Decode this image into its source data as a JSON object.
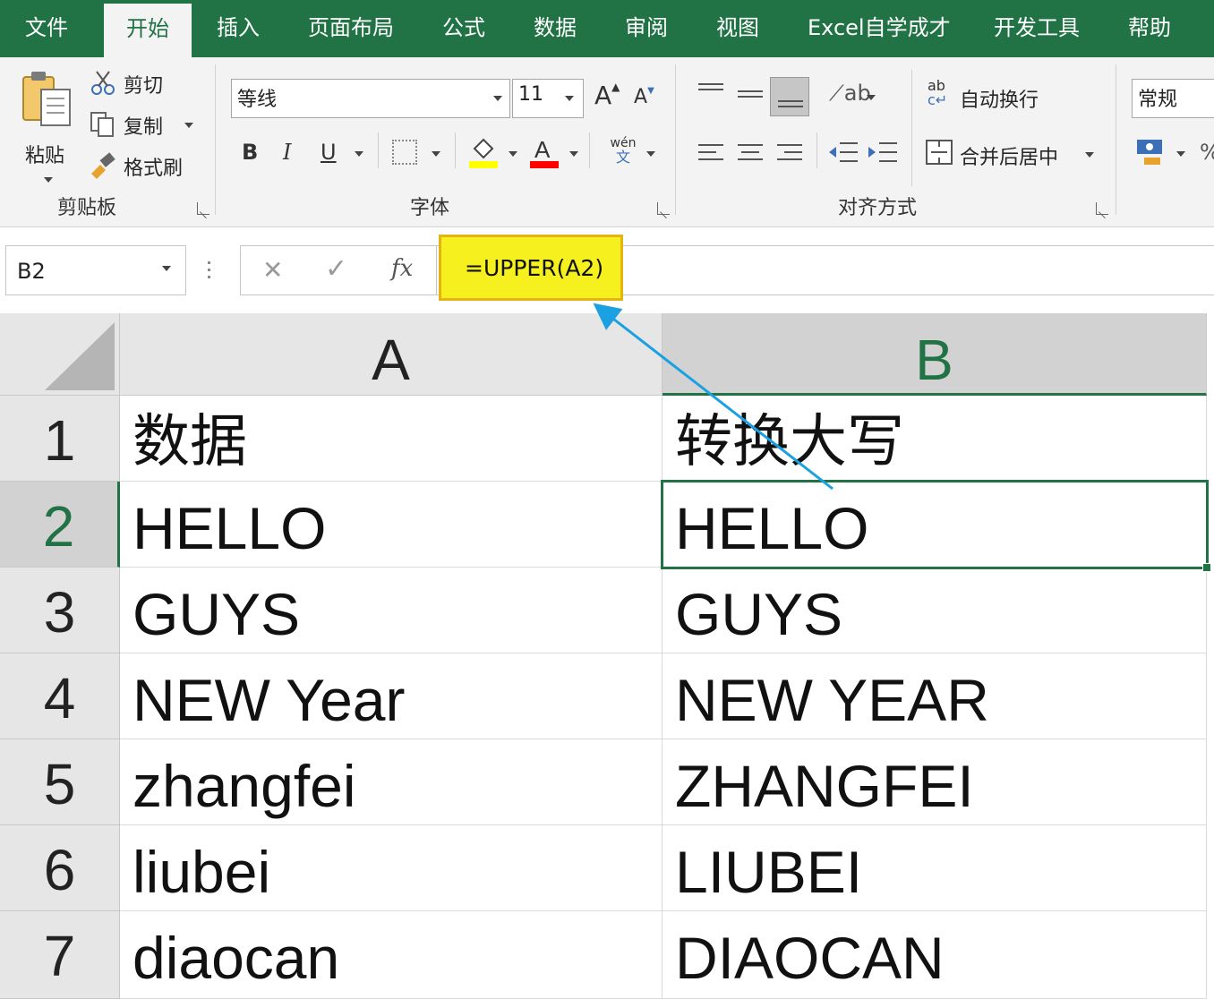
{
  "menu": {
    "tabs": [
      {
        "label": "文件"
      },
      {
        "label": "开始",
        "active": true
      },
      {
        "label": "插入"
      },
      {
        "label": "页面布局"
      },
      {
        "label": "公式"
      },
      {
        "label": "数据"
      },
      {
        "label": "审阅"
      },
      {
        "label": "视图"
      },
      {
        "label": "Excel自学成才"
      },
      {
        "label": "开发工具"
      },
      {
        "label": "帮助"
      }
    ]
  },
  "ribbon": {
    "clipboard": {
      "paste_label": "粘贴",
      "cut_label": "剪切",
      "copy_label": "复制",
      "format_painter_label": "格式刷",
      "group_label": "剪贴板"
    },
    "font": {
      "font_name": "等线",
      "font_size": "11",
      "bold": "B",
      "italic": "I",
      "underline": "U",
      "group_label": "字体",
      "fill_color": "#ffff00",
      "font_color": "#ff0000"
    },
    "alignment": {
      "wrap_text_label": "自动换行",
      "merge_center_label": "合并后居中",
      "group_label": "对齐方式"
    },
    "number": {
      "format": "常规"
    }
  },
  "formula_bar": {
    "name_box": "B2",
    "formula": "=UPPER(A2)",
    "highlight_color": "#f5f01e",
    "annotation_arrow_color": "#1ba1e2"
  },
  "sheet": {
    "columns": [
      "A",
      "B"
    ],
    "selected_column": "B",
    "selected_row": "2",
    "active_cell": "B2",
    "rows": [
      {
        "num": "1",
        "a": "数据",
        "b": "转换大写"
      },
      {
        "num": "2",
        "a": "HELLO",
        "b": "HELLO"
      },
      {
        "num": "3",
        "a": "GUYS",
        "b": "GUYS"
      },
      {
        "num": "4",
        "a": "NEW Year",
        "b": "NEW YEAR"
      },
      {
        "num": "5",
        "a": "zhangfei",
        "b": "ZHANGFEI"
      },
      {
        "num": "6",
        "a": "liubei",
        "b": "LIUBEI"
      },
      {
        "num": "7",
        "a": "diaocan",
        "b": "DIAOCAN"
      }
    ]
  },
  "colors": {
    "accent": "#217346"
  }
}
